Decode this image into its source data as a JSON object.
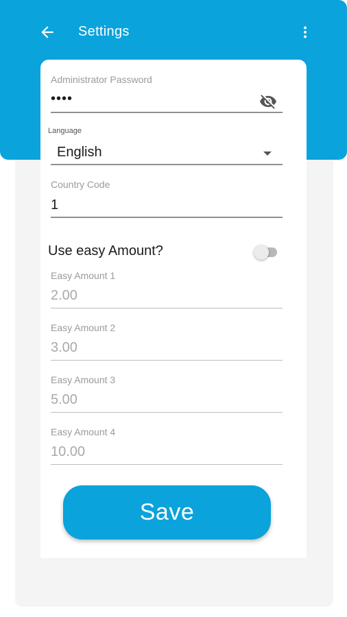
{
  "header": {
    "title": "Settings",
    "back_icon": "arrow-left-icon",
    "menu_icon": "more-vert-icon"
  },
  "form": {
    "admin_password": {
      "label": "Administrator Password",
      "value": "••••",
      "icon": "eye-off-icon"
    },
    "language": {
      "label": "Language",
      "value": "English"
    },
    "country_code": {
      "label": "Country Code",
      "value": "1"
    },
    "easy_amount_toggle": {
      "label": "Use easy Amount?",
      "enabled": false
    },
    "easy_amounts": [
      {
        "label": "Easy Amount 1",
        "value": "2.00"
      },
      {
        "label": "Easy Amount 2",
        "value": "3.00"
      },
      {
        "label": "Easy Amount 3",
        "value": "5.00"
      },
      {
        "label": "Easy Amount 4",
        "value": "10.00"
      }
    ],
    "save_label": "Save"
  },
  "colors": {
    "primary": "#0aa3dc",
    "background": "#f4f4f4"
  }
}
